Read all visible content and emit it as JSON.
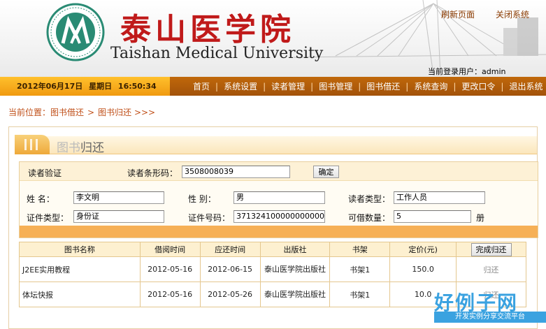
{
  "header": {
    "university_cn": "泰山医学院",
    "university_en": "Taishan Medical University",
    "links": {
      "refresh": "刷新页面",
      "close": "关闭系统"
    },
    "login_label": "当前登录用户：admin"
  },
  "navbar": {
    "date": "2012年06月17日",
    "weekday": "星期日",
    "time": "16:50:34",
    "items": [
      "首页",
      "系统设置",
      "读者管理",
      "图书管理",
      "图书借还",
      "系统查询",
      "更改口令",
      "退出系统"
    ]
  },
  "breadcrumb": {
    "prefix": "当前位置：",
    "level1": "图书借还",
    "level2": "图书归还",
    "suffix": ">>>"
  },
  "panel": {
    "title_hl": "图书",
    "title_rest": "归还"
  },
  "reader": {
    "section_label": "读者验证",
    "barcode_label": "读者条形码：",
    "barcode_value": "3508008039",
    "confirm_label": "确定",
    "name_label": "姓    名：",
    "name_value": "李文明",
    "gender_label": "性    别：",
    "gender_value": "男",
    "type_label": "读者类型：",
    "type_value": "工作人员",
    "id_type_label": "证件类型：",
    "id_type_value": "身份证",
    "id_no_label": "证件号码：",
    "id_no_value": "371324100000000000",
    "quota_label": "可借数量：",
    "quota_value": "5",
    "quota_unit": "册"
  },
  "table": {
    "headers": [
      "图书名称",
      "借阅时间",
      "应还时间",
      "出版社",
      "书架",
      "定价(元)"
    ],
    "return_all_label": "完成归还",
    "rows": [
      {
        "title": "J2EE实用教程",
        "borrow": "2012-05-16",
        "due": "2012-06-15",
        "publisher": "泰山医学院出版社",
        "shelf": "书架1",
        "price": "150.0",
        "action": "归还"
      },
      {
        "title": "体坛快报",
        "borrow": "2012-05-16",
        "due": "2012-05-26",
        "publisher": "泰山医学院出版社",
        "shelf": "书架1",
        "price": "10.0",
        "action": "归还"
      }
    ]
  },
  "watermark": {
    "big": "好例子网",
    "small": "开发实例分享交流平台"
  },
  "colors": {
    "nav_bg": "#a8560a",
    "date_bg": "#f7ae1e",
    "brand_red": "#c01a1a",
    "accent": "#f6b056"
  }
}
